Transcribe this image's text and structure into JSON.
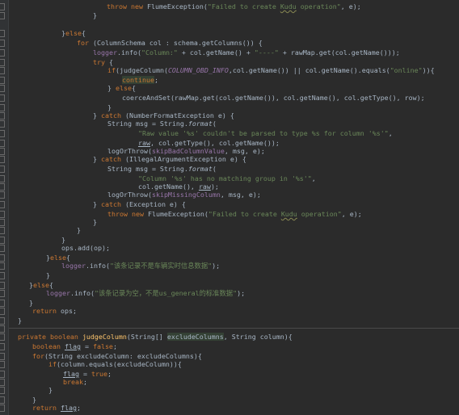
{
  "editor": {
    "colors": {
      "background": "#2b2b2b",
      "keyword": "#cc7832",
      "string": "#6a8759",
      "method": "#ffc66d",
      "field": "#9876aa",
      "plain": "#a9b7c6",
      "gutter": "#313335",
      "param_hint": "#8c8c8c"
    },
    "lines": [
      {
        "parts": [
          {
            "t": "throw new ",
            "c": "keyword"
          },
          {
            "t": "FlumeException(",
            "c": "plain"
          },
          {
            "t": "\"Failed to create ",
            "c": "string"
          },
          {
            "t": "Kudu",
            "c": "string",
            "s": "wavy"
          },
          {
            "t": " operation\"",
            "c": "string"
          },
          {
            "t": ", e);",
            "c": "plain"
          }
        ]
      },
      {
        "parts": [
          {
            "t": "}",
            "c": "plain"
          }
        ]
      },
      {
        "parts": [
          {
            "t": "}",
            "c": "plain"
          },
          {
            "t": "else",
            "c": "keyword"
          },
          {
            "t": "{",
            "c": "plain"
          }
        ]
      },
      {
        "parts": [
          {
            "t": "for ",
            "c": "keyword"
          },
          {
            "t": "(ColumnSchema col : schema.getColumns()) {",
            "c": "plain"
          }
        ]
      },
      {
        "parts": [
          {
            "t": "logger",
            "c": "field"
          },
          {
            "t": ".info(",
            "c": "plain"
          },
          {
            "t": "\"Column:\"",
            "c": "string"
          },
          {
            "t": " + col.getName() + ",
            "c": "plain"
          },
          {
            "t": "\"----\"",
            "c": "string"
          },
          {
            "t": " + rawMap.get(col.getName()));",
            "c": "plain"
          }
        ]
      },
      {
        "parts": [
          {
            "t": "try ",
            "c": "keyword"
          },
          {
            "t": "{",
            "c": "plain"
          }
        ]
      },
      {
        "parts": [
          {
            "t": "if",
            "c": "keyword"
          },
          {
            "t": "(judgeColumn(",
            "c": "plain"
          },
          {
            "t": "COLUMN_OBD_INFO",
            "c": "field",
            "s": "italic"
          },
          {
            "t": ",col.getName()) || col.getName().equals(",
            "c": "plain"
          },
          {
            "t": "\"online\"",
            "c": "string"
          },
          {
            "t": ")){",
            "c": "plain"
          }
        ]
      },
      {
        "parts": [
          {
            "t": "continue",
            "c": "keyword",
            "s": "hl"
          },
          {
            "t": ";",
            "c": "plain"
          }
        ]
      },
      {
        "parts": [
          {
            "t": "} ",
            "c": "plain"
          },
          {
            "t": "else",
            "c": "keyword"
          },
          {
            "t": "{",
            "c": "plain"
          }
        ]
      },
      {
        "parts": [
          {
            "t": "coerceAndSet(rawMap.get(col.getName()), col.getName(), col.getType(), row);",
            "c": "plain"
          }
        ]
      },
      {
        "parts": [
          {
            "t": "}",
            "c": "plain"
          }
        ]
      },
      {
        "parts": [
          {
            "t": "} ",
            "c": "plain"
          },
          {
            "t": "catch ",
            "c": "keyword"
          },
          {
            "t": "(NumberFormatException e) {",
            "c": "plain"
          }
        ]
      },
      {
        "parts": [
          {
            "t": "String msg = String.",
            "c": "plain"
          },
          {
            "t": "format",
            "c": "plain",
            "s": "italic"
          },
          {
            "t": "(",
            "c": "plain"
          }
        ]
      },
      {
        "parts": [
          {
            "t": "\"Raw value '%s' couldn't be parsed to type %s for column '%s'\"",
            "c": "string"
          },
          {
            "t": ",",
            "c": "plain"
          }
        ]
      },
      {
        "parts": [
          {
            "t": "raw",
            "c": "plain",
            "s": "ul"
          },
          {
            "t": ", col.getType(), col.getName());",
            "c": "plain"
          }
        ]
      },
      {
        "parts": [
          {
            "t": "logOrThrow(",
            "c": "plain"
          },
          {
            "t": "skipBadColumnValue",
            "c": "field"
          },
          {
            "t": ", msg, e);",
            "c": "plain"
          }
        ]
      },
      {
        "parts": [
          {
            "t": "} ",
            "c": "plain"
          },
          {
            "t": "catch ",
            "c": "keyword"
          },
          {
            "t": "(IllegalArgumentException e) {",
            "c": "plain"
          }
        ]
      },
      {
        "parts": [
          {
            "t": "String msg = String.",
            "c": "plain"
          },
          {
            "t": "format",
            "c": "plain",
            "s": "italic"
          },
          {
            "t": "(",
            "c": "plain"
          }
        ]
      },
      {
        "parts": [
          {
            "t": "\"Column '%s' has no matching group in '%s'\"",
            "c": "string"
          },
          {
            "t": ",",
            "c": "plain"
          }
        ]
      },
      {
        "parts": [
          {
            "t": "col.getName(), ",
            "c": "plain"
          },
          {
            "t": "raw",
            "c": "plain",
            "s": "ul"
          },
          {
            "t": ");",
            "c": "plain"
          }
        ]
      },
      {
        "parts": [
          {
            "t": "logOrThrow(",
            "c": "plain"
          },
          {
            "t": "skipMissingColumn",
            "c": "field"
          },
          {
            "t": ", msg, e);",
            "c": "plain"
          }
        ]
      },
      {
        "parts": [
          {
            "t": "} ",
            "c": "plain"
          },
          {
            "t": "catch ",
            "c": "keyword"
          },
          {
            "t": "(Exception e) {",
            "c": "plain"
          }
        ]
      },
      {
        "parts": [
          {
            "t": "throw new ",
            "c": "keyword"
          },
          {
            "t": "FlumeException(",
            "c": "plain"
          },
          {
            "t": "\"Failed to create ",
            "c": "string"
          },
          {
            "t": "Kudu",
            "c": "string",
            "s": "wavy"
          },
          {
            "t": " operation\"",
            "c": "string"
          },
          {
            "t": ", e);",
            "c": "plain"
          }
        ]
      },
      {
        "parts": [
          {
            "t": "}",
            "c": "plain"
          }
        ]
      },
      {
        "parts": [
          {
            "t": "}",
            "c": "plain"
          }
        ]
      },
      {
        "parts": [
          {
            "t": "}",
            "c": "plain"
          }
        ]
      },
      {
        "parts": [
          {
            "t": "ops.add(op);",
            "c": "plain"
          }
        ]
      },
      {
        "parts": [
          {
            "t": "}",
            "c": "plain"
          },
          {
            "t": "else",
            "c": "keyword"
          },
          {
            "t": "{",
            "c": "plain"
          }
        ]
      },
      {
        "parts": [
          {
            "t": "logger",
            "c": "field"
          },
          {
            "t": ".info(",
            "c": "plain"
          },
          {
            "t": "\"该条记录不是车辆实时信息数据\"",
            "c": "string"
          },
          {
            "t": ");",
            "c": "plain"
          }
        ]
      },
      {
        "parts": [
          {
            "t": "}",
            "c": "plain"
          }
        ]
      },
      {
        "parts": [
          {
            "t": "}",
            "c": "plain"
          },
          {
            "t": "else",
            "c": "keyword"
          },
          {
            "t": "{",
            "c": "plain"
          }
        ]
      },
      {
        "parts": [
          {
            "t": "logger",
            "c": "field"
          },
          {
            "t": ".info(",
            "c": "plain"
          },
          {
            "t": "\"该条记录为空，不是us_general的标准数据\"",
            "c": "string"
          },
          {
            "t": ");",
            "c": "plain"
          }
        ]
      },
      {
        "parts": [
          {
            "t": "}",
            "c": "plain"
          }
        ]
      },
      {
        "parts": [
          {
            "t": "return ",
            "c": "keyword"
          },
          {
            "t": "ops;",
            "c": "plain"
          }
        ]
      },
      {
        "parts": [
          {
            "t": "}",
            "c": "plain"
          }
        ]
      },
      {
        "parts": []
      },
      {
        "parts": [
          {
            "t": "private boolean ",
            "c": "keyword"
          },
          {
            "t": "judgeColumn",
            "c": "method"
          },
          {
            "t": "(String[] ",
            "c": "plain"
          },
          {
            "t": "excludeColumns",
            "c": "plain",
            "s": "hl"
          },
          {
            "t": ", String column){",
            "c": "plain"
          }
        ]
      },
      {
        "parts": [
          {
            "t": "boolean ",
            "c": "keyword"
          },
          {
            "t": "flag",
            "c": "plain",
            "s": "ul"
          },
          {
            "t": " = ",
            "c": "plain"
          },
          {
            "t": "false",
            "c": "keyword"
          },
          {
            "t": ";",
            "c": "plain"
          }
        ]
      },
      {
        "parts": [
          {
            "t": "for",
            "c": "keyword"
          },
          {
            "t": "(String excludeColumn: excludeColumns){",
            "c": "plain"
          }
        ]
      },
      {
        "parts": [
          {
            "t": "if",
            "c": "keyword"
          },
          {
            "t": "(column.equals(excludeColumn)){",
            "c": "plain"
          }
        ]
      },
      {
        "parts": [
          {
            "t": "flag",
            "c": "plain",
            "s": "ul"
          },
          {
            "t": " = ",
            "c": "plain"
          },
          {
            "t": "true",
            "c": "keyword"
          },
          {
            "t": ";",
            "c": "plain"
          }
        ]
      },
      {
        "parts": [
          {
            "t": "break",
            "c": "keyword"
          },
          {
            "t": ";",
            "c": "plain"
          }
        ]
      },
      {
        "parts": [
          {
            "t": "}",
            "c": "plain"
          }
        ]
      },
      {
        "parts": [
          {
            "t": "}",
            "c": "plain"
          }
        ]
      },
      {
        "parts": [
          {
            "t": "return ",
            "c": "keyword"
          },
          {
            "t": "flag",
            "c": "plain",
            "s": "ul"
          },
          {
            "t": ";",
            "c": "plain"
          }
        ]
      }
    ]
  }
}
